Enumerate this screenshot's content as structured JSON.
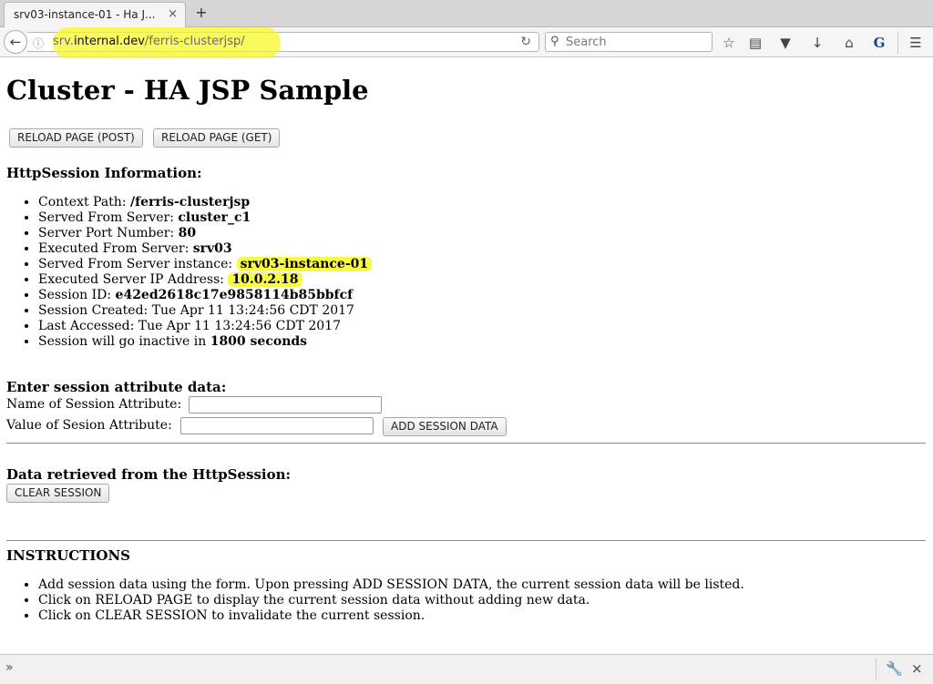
{
  "browser": {
    "tab_title": "srv03-instance-01 - Ha J...",
    "tab_close": "×",
    "new_tab": "+",
    "url_prefix": "srv.",
    "url_domain": "internal.dev",
    "url_path": "/ferris-clusterjsp/",
    "search_placeholder": "Search",
    "highlight_color": "#f8f828"
  },
  "page": {
    "title": "Cluster - HA JSP Sample",
    "reload_post_label": "RELOAD PAGE (POST)",
    "reload_get_label": "RELOAD PAGE (GET)",
    "session_info_heading": "HttpSession Information:",
    "session_info": {
      "context_path_label": "Context Path: ",
      "context_path": "/ferris-clusterjsp",
      "served_from_server_label": "Served From Server: ",
      "served_from_server": "cluster_c1",
      "server_port_label": "Server Port Number: ",
      "server_port": "80",
      "executed_from_server_label": "Executed From Server: ",
      "executed_from_server": "srv03",
      "served_instance_label": "Served From Server instance: ",
      "served_instance": "srv03-instance-01",
      "executed_ip_label": "Executed Server IP Address: ",
      "executed_ip": "10.0.2.18",
      "session_id_label": "Session ID: ",
      "session_id": "e42ed2618c17e9858114b85bbfcf",
      "session_created": "Session Created: Tue Apr 11 13:24:56 CDT 2017",
      "last_accessed": "Last Accessed: Tue Apr 11 13:24:56 CDT 2017",
      "inactive_prefix": "Session will go inactive in ",
      "inactive_value": "1800 seconds"
    },
    "attr_heading": "Enter session attribute data:",
    "attr_name_label": "Name of Session Attribute:",
    "attr_name_value": "",
    "attr_value_label": "Value of Sesion Attribute:",
    "attr_value_value": "",
    "add_session_label": "ADD SESSION DATA",
    "retrieved_heading": "Data retrieved from the HttpSession:",
    "clear_session_label": "CLEAR SESSION",
    "instructions_heading": "INSTRUCTIONS",
    "instructions": [
      "Add session data using the form. Upon pressing ADD SESSION DATA, the current session data will be listed.",
      "Click on RELOAD PAGE to display the current session data without adding new data.",
      "Click on CLEAR SESSION to invalidate the current session."
    ]
  },
  "bottombar": {
    "left_icon": "»",
    "wrench_icon": "wrench-icon",
    "close_icon": "×"
  }
}
